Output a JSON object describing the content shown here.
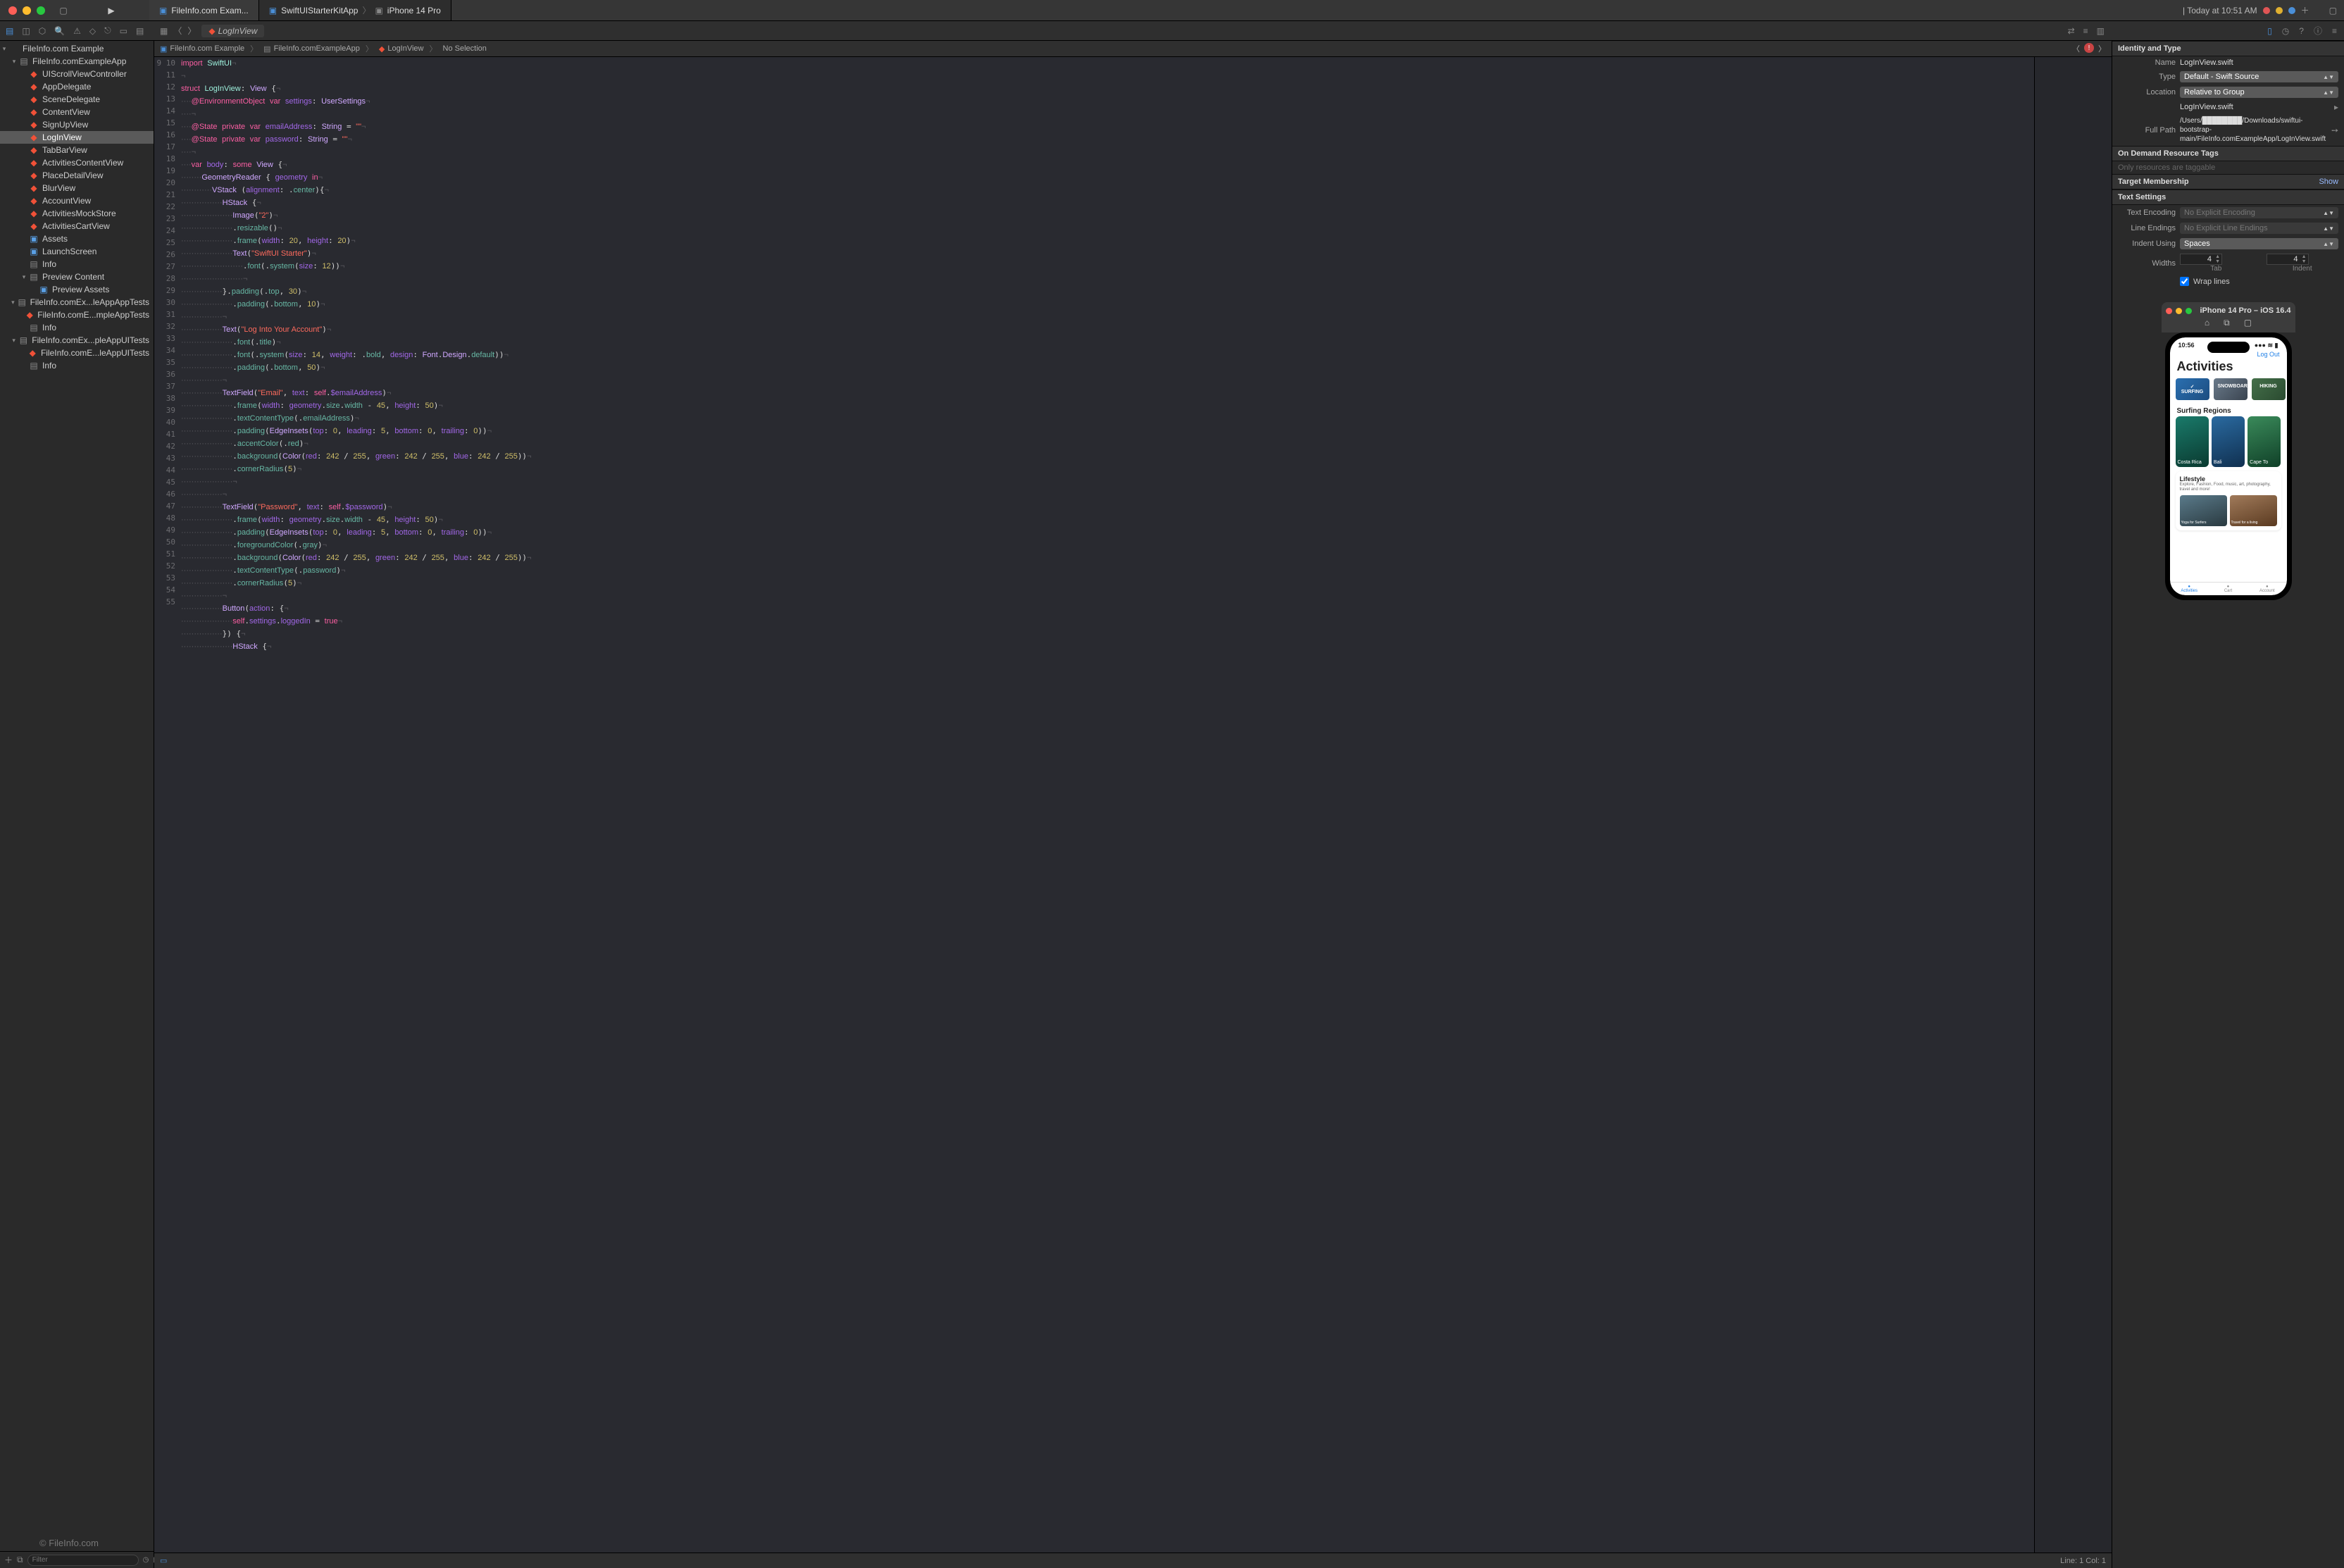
{
  "titlebar": {
    "tab1": "FileInfo.com Exam...",
    "tab2": "SwiftUIStarterKitApp",
    "tab2_dest": "iPhone 14 Pro",
    "status": "| Today at 10:51 AM"
  },
  "open_file_tab": "LogInView",
  "jumpbar": {
    "p1": "FileInfo.com Example",
    "p2": "FileInfo.comExampleApp",
    "p3": "LogInView",
    "p4": "No Selection"
  },
  "navigator": {
    "project": "FileInfo.com Example",
    "group1": "FileInfo.comExampleApp",
    "files1": [
      "UIScrollViewController",
      "AppDelegate",
      "SceneDelegate",
      "ContentView",
      "SignUpView",
      "LogInView",
      "TabBarView",
      "ActivitiesContentView",
      "PlaceDetailView",
      "BlurView",
      "AccountView",
      "ActivitiesMockStore",
      "ActivitiesCartView"
    ],
    "assets": "Assets",
    "launch": "LaunchScreen",
    "info": "Info",
    "preview_grp": "Preview Content",
    "preview_assets": "Preview Assets",
    "group2": "FileInfo.comEx...leAppAppTests",
    "file2": "FileInfo.comE...mpleAppTests",
    "info2": "Info",
    "group3": "FileInfo.comEx...pleAppUITests",
    "file3": "FileInfo.comE...leAppUITests",
    "info3": "Info",
    "filter_ph": "Filter"
  },
  "code_lines": [
    {
      "n": 9,
      "h": "<span class=kw>import</span> <span class=type>SwiftUI</span><span class=inv>¬</span>"
    },
    {
      "n": 10,
      "h": "<span class=inv>¬</span>"
    },
    {
      "n": 11,
      "h": "<span class=kw>struct</span> <span class=type>LogInView</span>: <span class=typeP>View</span> {<span class=inv>¬</span>"
    },
    {
      "n": 12,
      "h": "<span class=inv>····</span><span class=attr>@EnvironmentObject</span> <span class=kw>var</span> <span class=id>settings</span>: <span class=typeP>UserSettings</span><span class=inv>¬</span>"
    },
    {
      "n": 13,
      "h": "<span class=inv>····¬</span>"
    },
    {
      "n": 14,
      "h": "<span class=inv>····</span><span class=attr>@State</span> <span class=kw>private</span> <span class=kw>var</span> <span class=id>emailAddress</span>: <span class=typeP>String</span> = <span class=str>\"\"</span><span class=inv>¬</span>"
    },
    {
      "n": 15,
      "h": "<span class=inv>····</span><span class=attr>@State</span> <span class=kw>private</span> <span class=kw>var</span> <span class=id>password</span>: <span class=typeP>String</span> = <span class=str>\"\"</span><span class=inv>¬</span>"
    },
    {
      "n": 16,
      "h": "<span class=inv>····¬</span>"
    },
    {
      "n": 17,
      "h": "<span class=inv>····</span><span class=kw>var</span> <span class=id>body</span>: <span class=kw>some</span> <span class=typeP>View</span> {<span class=inv>¬</span>"
    },
    {
      "n": 18,
      "h": "<span class=inv>········</span><span class=typeP>GeometryReader</span> { <span class=id>geometry</span> <span class=kw>in</span><span class=inv>¬</span>"
    },
    {
      "n": 19,
      "h": "<span class=inv>············</span><span class=typeP>VStack</span> (<span class=id>alignment</span>: .<span class=fn>center</span>){<span class=inv>¬</span>"
    },
    {
      "n": 20,
      "h": "<span class=inv>················</span><span class=typeP>HStack</span> {<span class=inv>¬</span>"
    },
    {
      "n": 21,
      "h": "<span class=inv>····················</span><span class=typeP>Image</span>(<span class=str>\"2\"</span>)<span class=inv>¬</span>"
    },
    {
      "n": 22,
      "h": "<span class=inv>····················</span>.<span class=fn>resizable</span>()<span class=inv>¬</span>"
    },
    {
      "n": 23,
      "h": "<span class=inv>····················</span>.<span class=fn>frame</span>(<span class=id>width</span>: <span class=num>20</span>, <span class=id>height</span>: <span class=num>20</span>)<span class=inv>¬</span>"
    },
    {
      "n": 24,
      "h": "<span class=inv>····················</span><span class=typeP>Text</span>(<span class=str>\"SwiftUI Starter\"</span>)<span class=inv>¬</span>"
    },
    {
      "n": 25,
      "h": "<span class=inv>························</span>.<span class=fn>font</span>(.<span class=fn>system</span>(<span class=id>size</span>: <span class=num>12</span>))<span class=inv>¬</span>"
    },
    {
      "n": 26,
      "h": "<span class=inv>························¬</span>"
    },
    {
      "n": 27,
      "h": "<span class=inv>················</span>}.<span class=fn>padding</span>(.<span class=fn>top</span>, <span class=num>30</span>)<span class=inv>¬</span>"
    },
    {
      "n": 28,
      "h": "<span class=inv>····················</span>.<span class=fn>padding</span>(.<span class=fn>bottom</span>, <span class=num>10</span>)<span class=inv>¬</span>"
    },
    {
      "n": 29,
      "h": "<span class=inv>················¬</span>"
    },
    {
      "n": 30,
      "h": "<span class=inv>················</span><span class=typeP>Text</span>(<span class=str>\"Log Into Your Account\"</span>)<span class=inv>¬</span>"
    },
    {
      "n": 31,
      "h": "<span class=inv>····················</span>.<span class=fn>font</span>(.<span class=fn>title</span>)<span class=inv>¬</span>"
    },
    {
      "n": 32,
      "h": "<span class=inv>····················</span>.<span class=fn>font</span>(.<span class=fn>system</span>(<span class=id>size</span>: <span class=num>14</span>, <span class=id>weight</span>: .<span class=fn>bold</span>, <span class=id>design</span>: <span class=typeP>Font</span>.<span class=typeP>Design</span>.<span class=fn>default</span>))<span class=inv>¬</span>"
    },
    {
      "n": 33,
      "h": "<span class=inv>····················</span>.<span class=fn>padding</span>(.<span class=fn>bottom</span>, <span class=num>50</span>)<span class=inv>¬</span>"
    },
    {
      "n": 34,
      "h": "<span class=inv>················¬</span>"
    },
    {
      "n": 35,
      "h": "<span class=inv>················</span><span class=typeP>TextField</span>(<span class=str>\"Email\"</span>, <span class=id>text</span>: <span class=kw>self</span>.<span class=id>$emailAddress</span>)<span class=inv>¬</span>"
    },
    {
      "n": 36,
      "h": "<span class=inv>····················</span>.<span class=fn>frame</span>(<span class=id>width</span>: <span class=id>geometry</span>.<span class=fn>size</span>.<span class=fn>width</span> - <span class=num>45</span>, <span class=id>height</span>: <span class=num>50</span>)<span class=inv>¬</span>"
    },
    {
      "n": 37,
      "h": "<span class=inv>····················</span>.<span class=fn>textContentType</span>(.<span class=fn>emailAddress</span>)<span class=inv>¬</span>"
    },
    {
      "n": 38,
      "h": "<span class=inv>····················</span>.<span class=fn>padding</span>(<span class=typeP>EdgeInsets</span>(<span class=id>top</span>: <span class=num>0</span>, <span class=id>leading</span>: <span class=num>5</span>, <span class=id>bottom</span>: <span class=num>0</span>, <span class=id>trailing</span>: <span class=num>0</span>))<span class=inv>¬</span>"
    },
    {
      "n": 39,
      "h": "<span class=inv>····················</span>.<span class=fn>accentColor</span>(.<span class=fn>red</span>)<span class=inv>¬</span>"
    },
    {
      "n": 40,
      "h": "<span class=inv>····················</span>.<span class=fn>background</span>(<span class=typeP>Color</span>(<span class=id>red</span>: <span class=num>242</span> / <span class=num>255</span>, <span class=id>green</span>: <span class=num>242</span> / <span class=num>255</span>, <span class=id>blue</span>: <span class=num>242</span> / <span class=num>255</span>))<span class=inv>¬</span>"
    },
    {
      "n": 41,
      "h": "<span class=inv>····················</span>.<span class=fn>cornerRadius</span>(<span class=num>5</span>)<span class=inv>¬</span>"
    },
    {
      "n": 42,
      "h": "<span class=inv>····················¬</span>"
    },
    {
      "n": 43,
      "h": "<span class=inv>················¬</span>"
    },
    {
      "n": 44,
      "h": "<span class=inv>················</span><span class=typeP>TextField</span>(<span class=str>\"Password\"</span>, <span class=id>text</span>: <span class=kw>self</span>.<span class=id>$password</span>)<span class=inv>¬</span>"
    },
    {
      "n": 45,
      "h": "<span class=inv>····················</span>.<span class=fn>frame</span>(<span class=id>width</span>: <span class=id>geometry</span>.<span class=fn>size</span>.<span class=fn>width</span> - <span class=num>45</span>, <span class=id>height</span>: <span class=num>50</span>)<span class=inv>¬</span>"
    },
    {
      "n": 46,
      "h": "<span class=inv>····················</span>.<span class=fn>padding</span>(<span class=typeP>EdgeInsets</span>(<span class=id>top</span>: <span class=num>0</span>, <span class=id>leading</span>: <span class=num>5</span>, <span class=id>bottom</span>: <span class=num>0</span>, <span class=id>trailing</span>: <span class=num>0</span>))<span class=inv>¬</span>"
    },
    {
      "n": 47,
      "h": "<span class=inv>····················</span>.<span class=fn>foregroundColor</span>(.<span class=fn>gray</span>)<span class=inv>¬</span>"
    },
    {
      "n": 48,
      "h": "<span class=inv>····················</span>.<span class=fn>background</span>(<span class=typeP>Color</span>(<span class=id>red</span>: <span class=num>242</span> / <span class=num>255</span>, <span class=id>green</span>: <span class=num>242</span> / <span class=num>255</span>, <span class=id>blue</span>: <span class=num>242</span> / <span class=num>255</span>))<span class=inv>¬</span>"
    },
    {
      "n": 49,
      "h": "<span class=inv>····················</span>.<span class=fn>textContentType</span>(.<span class=fn>password</span>)<span class=inv>¬</span>"
    },
    {
      "n": 50,
      "h": "<span class=inv>····················</span>.<span class=fn>cornerRadius</span>(<span class=num>5</span>)<span class=inv>¬</span>"
    },
    {
      "n": 51,
      "h": "<span class=inv>················¬</span>"
    },
    {
      "n": 52,
      "h": "<span class=inv>················</span><span class=typeP>Button</span>(<span class=id>action</span>: {<span class=inv>¬</span>"
    },
    {
      "n": 53,
      "h": "<span class=inv>····················</span><span class=kw>self</span>.<span class=id>settings</span>.<span class=id>loggedIn</span> = <span class=kw>true</span><span class=inv>¬</span>"
    },
    {
      "n": 54,
      "h": "<span class=inv>················</span>}) {<span class=inv>¬</span>"
    },
    {
      "n": 55,
      "h": "<span class=inv>····················</span><span class=typeP>HStack</span> {<span class=inv>¬</span>"
    }
  ],
  "statusbar": {
    "pos": "Line: 1  Col: 1"
  },
  "inspector": {
    "hdr1": "Identity and Type",
    "name_lbl": "Name",
    "name_val": "LogInView.swift",
    "type_lbl": "Type",
    "type_val": "Default - Swift Source",
    "loc_lbl": "Location",
    "loc_val": "Relative to Group",
    "loc_file": "LogInView.swift",
    "fullpath_lbl": "Full Path",
    "fullpath_val": "/Users/████████/Downloads/swiftui-bootstrap-main/FileInfo.comExampleApp/LogInView.swift",
    "hdr2": "On Demand Resource Tags",
    "tags_ph": "Only resources are taggable",
    "hdr3": "Target Membership",
    "show": "Show",
    "hdr4": "Text Settings",
    "enc_lbl": "Text Encoding",
    "enc_val": "No Explicit Encoding",
    "le_lbl": "Line Endings",
    "le_val": "No Explicit Line Endings",
    "ind_lbl": "Indent Using",
    "ind_val": "Spaces",
    "widths_lbl": "Widths",
    "tab_val": "4",
    "indent_val": "4",
    "tab_cap": "Tab",
    "indent_cap": "Indent",
    "wrap": "Wrap lines"
  },
  "sim": {
    "title": "iPhone 14 Pro – iOS 16.4",
    "time": "10:56",
    "logout": "Log Out",
    "h1": "Activities",
    "chips": [
      "✓ SURFING",
      "SNOWBOARD",
      "HIKING"
    ],
    "sect": "Surfing Regions",
    "cards": [
      "Costa Rica",
      "Bali",
      "Cape To"
    ],
    "life_h": "Lifestyle",
    "life_p": "Explore, Fashion, Food, music, art, photography, travel and more!",
    "life_cards": [
      "Yoga for Surfers",
      "Travel for a living"
    ],
    "tabs": [
      "Activities",
      "Cart",
      "Account"
    ]
  },
  "watermark": "© FileInfo.com"
}
